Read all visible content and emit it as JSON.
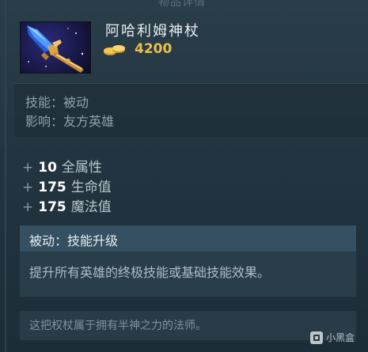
{
  "header_partial": "物品详情",
  "item": {
    "name": "阿哈利姆神杖",
    "icon": "aghanims-scepter-icon",
    "gold_icon": "gold-coins-icon",
    "cost": "4200"
  },
  "meta": {
    "ability_type": "技能：被动",
    "affects": "影响：友方英雄"
  },
  "attributes": [
    {
      "sign": "+",
      "value": "10",
      "label": "全属性"
    },
    {
      "sign": "+",
      "value": "175",
      "label": "生命值"
    },
    {
      "sign": "+",
      "value": "175",
      "label": "魔法值"
    }
  ],
  "ability": {
    "title": "被动：技能升级",
    "description": "提升所有英雄的终极技能或基础技能效果。"
  },
  "lore": "这把权杖属于拥有半神之力的法师。",
  "watermark": {
    "text": "小黑盒"
  },
  "colors": {
    "gold": "#e8c14a",
    "panel": "#223440",
    "ability_header": "#355060"
  }
}
